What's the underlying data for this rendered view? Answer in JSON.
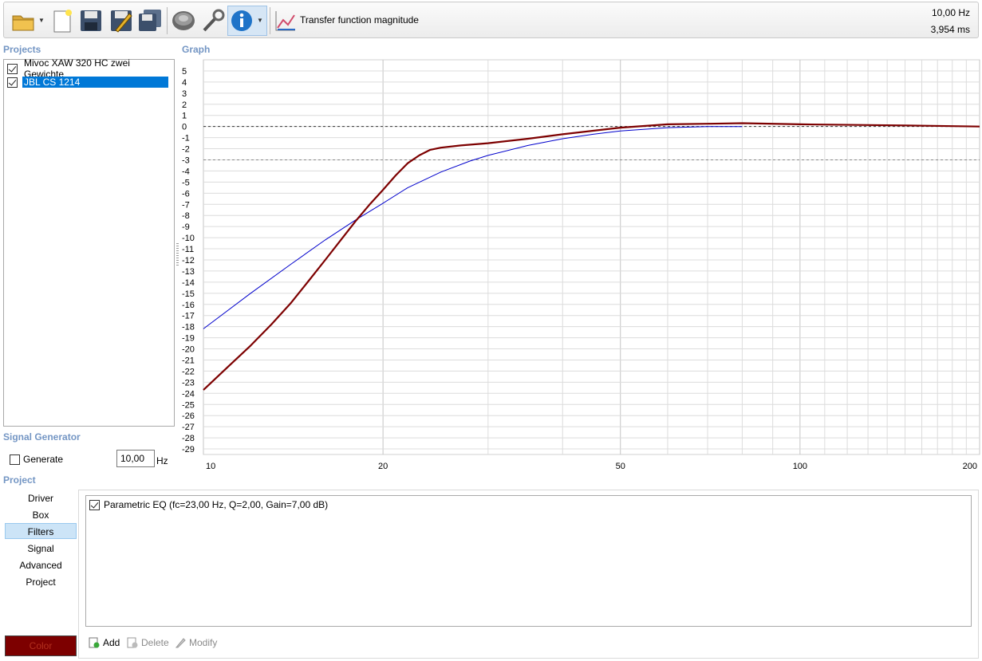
{
  "toolbar": {
    "buttons": [
      {
        "name": "open-folder-icon"
      },
      {
        "name": "new-file-icon"
      },
      {
        "name": "save-icon"
      },
      {
        "name": "save-edit-icon"
      },
      {
        "name": "save-all-icon"
      },
      {
        "name": "driver-icon"
      },
      {
        "name": "tools-wrench-icon"
      },
      {
        "name": "info-icon"
      },
      {
        "name": "chart-icon"
      }
    ],
    "view_title": "Transfer function magnitude",
    "readout_freq": "10,00 Hz",
    "readout_time": "3,954 ms"
  },
  "sections": {
    "projects": "Projects",
    "graph": "Graph",
    "signal_generator": "Signal Generator",
    "project": "Project"
  },
  "projects": [
    {
      "label": "Mivoc XAW 320 HC zwei Gewichte",
      "checked": true,
      "selected": false
    },
    {
      "label": "JBL CS 1214",
      "checked": true,
      "selected": true
    }
  ],
  "signal_generator": {
    "generate_label": "Generate",
    "generate_checked": false,
    "frequency_value": "10,00",
    "unit": "Hz"
  },
  "project_nav": [
    {
      "label": "Driver",
      "active": false
    },
    {
      "label": "Box",
      "active": false
    },
    {
      "label": "Filters",
      "active": true
    },
    {
      "label": "Signal",
      "active": false
    },
    {
      "label": "Advanced",
      "active": false
    },
    {
      "label": "Project",
      "active": false
    }
  ],
  "color_button": {
    "label": "Color",
    "color": "#7d0000"
  },
  "filters": {
    "items": [
      {
        "label": "Parametric EQ (fc=23,00 Hz, Q=2,00, Gain=7,00 dB)",
        "checked": true
      }
    ],
    "add_label": "Add",
    "delete_label": "Delete",
    "modify_label": "Modify"
  },
  "chart_data": {
    "type": "line",
    "x_scale": "log",
    "xlim": [
      10,
      200
    ],
    "ylim": [
      -29,
      5
    ],
    "x_ticks": [
      {
        "value": 10,
        "label": "10"
      },
      {
        "value": 20,
        "label": "20"
      },
      {
        "value": 50,
        "label": "50"
      },
      {
        "value": 100,
        "label": "100"
      },
      {
        "value": 200,
        "label": "200"
      }
    ],
    "y_ticks": [
      5,
      4,
      3,
      2,
      1,
      0,
      -1,
      -2,
      -3,
      -4,
      -5,
      -6,
      -7,
      -8,
      -9,
      -10,
      -11,
      -12,
      -13,
      -14,
      -15,
      -16,
      -17,
      -18,
      -19,
      -20,
      -21,
      -22,
      -23,
      -24,
      -25,
      -26,
      -27,
      -28,
      -29
    ],
    "reference_lines": [
      0,
      -3
    ],
    "grid": true,
    "series": [
      {
        "color": "#7d0000",
        "x": [
          10,
          11,
          12,
          13,
          14,
          15,
          16,
          17,
          18,
          19,
          20,
          21,
          22,
          23,
          24,
          25,
          27,
          30,
          35,
          40,
          50,
          60,
          70,
          80,
          100,
          150,
          200
        ],
        "y": [
          -23.7,
          -21.6,
          -19.7,
          -17.8,
          -15.9,
          -13.9,
          -12.0,
          -10.2,
          -8.5,
          -7.0,
          -5.7,
          -4.4,
          -3.3,
          -2.6,
          -2.1,
          -1.9,
          -1.7,
          -1.5,
          -1.1,
          -0.7,
          -0.1,
          0.2,
          0.25,
          0.3,
          0.2,
          0.1,
          0.0
        ]
      },
      {
        "color": "#0000cc",
        "x": [
          10,
          12,
          14,
          16,
          18,
          20,
          22,
          25,
          28,
          30,
          35,
          40,
          45,
          50,
          60,
          70,
          80
        ],
        "y": [
          -18.2,
          -15.0,
          -12.4,
          -10.2,
          -8.4,
          -6.9,
          -5.5,
          -4.1,
          -3.1,
          -2.6,
          -1.7,
          -1.1,
          -0.7,
          -0.4,
          -0.1,
          0.0,
          0.0
        ]
      }
    ]
  }
}
